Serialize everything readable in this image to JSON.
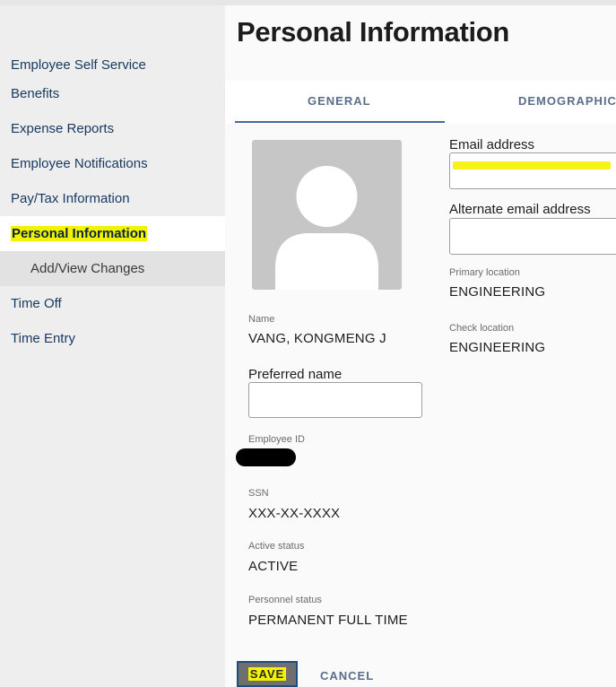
{
  "sidebar": {
    "items": [
      {
        "label": "Employee Self Service"
      },
      {
        "label": "Benefits"
      },
      {
        "label": "Expense Reports"
      },
      {
        "label": "Employee Notifications"
      },
      {
        "label": "Pay/Tax Information"
      },
      {
        "label": "Personal Information",
        "active": true
      },
      {
        "label": "Add/View Changes",
        "sub": true
      },
      {
        "label": "Time Off"
      },
      {
        "label": "Time Entry"
      }
    ]
  },
  "page": {
    "title": "Personal Information"
  },
  "tabs": [
    {
      "label": "GENERAL",
      "active": true
    },
    {
      "label": "DEMOGRAPHIC"
    }
  ],
  "profile": {
    "avatar_icon": "user-silhouette-icon",
    "name_label": "Name",
    "name_value": "VANG, KONGMENG J",
    "preferred_name_label": "Preferred name",
    "preferred_name_value": "",
    "employee_id_label": "Employee ID",
    "ssn_label": "SSN",
    "ssn_value": "XXX-XX-XXXX",
    "active_status_label": "Active status",
    "active_status_value": "ACTIVE",
    "personnel_status_label": "Personnel status",
    "personnel_status_value": "PERMANENT FULL TIME"
  },
  "contact": {
    "email_label": "Email address",
    "email_value": "",
    "alt_email_label": "Alternate email address",
    "alt_email_value": "",
    "primary_location_label": "Primary location",
    "primary_location_value": "ENGINEERING",
    "check_location_label": "Check location",
    "check_location_value": "ENGINEERING"
  },
  "actions": {
    "save_label": "SAVE",
    "cancel_label": "CANCEL"
  },
  "colors": {
    "nav_text": "#17385f",
    "tab_indicator": "#466a9a",
    "highlight": "#f3f300",
    "avatar_bg": "#c6c6c6"
  }
}
